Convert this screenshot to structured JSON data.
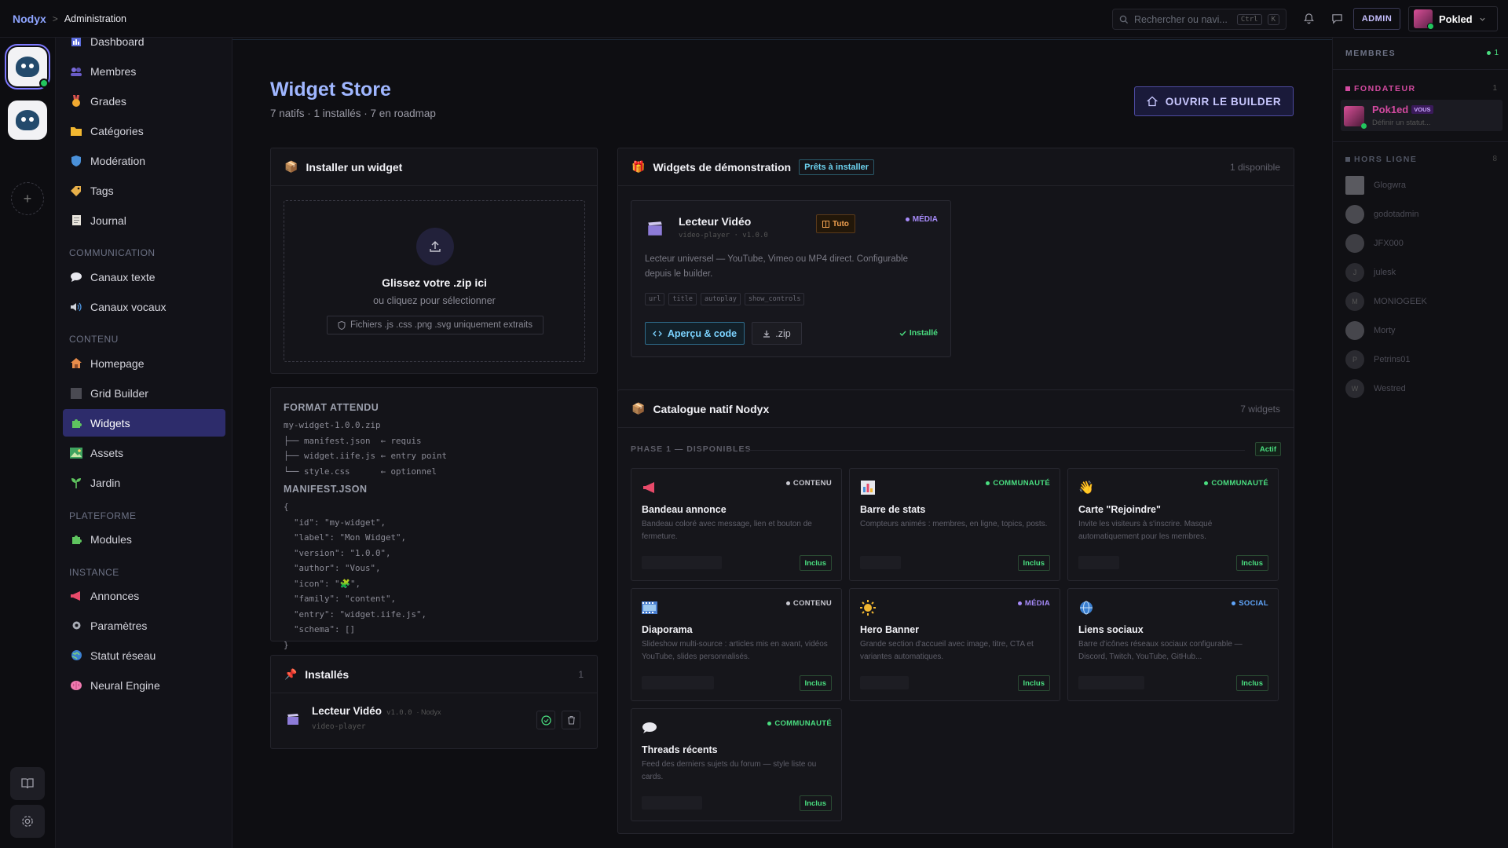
{
  "topbar": {
    "brand": "Nodyx",
    "separator": ">",
    "page": "Administration",
    "search_placeholder": "Rechercher ou navi...",
    "kbd1": "Ctrl",
    "kbd2": "K",
    "admin_badge": "ADMIN",
    "user_name": "Pokled"
  },
  "sidebar": {
    "items": [
      {
        "label": "Dashboard",
        "icon": "dashboard-icon"
      },
      {
        "label": "Membres",
        "icon": "members-icon"
      },
      {
        "label": "Grades",
        "icon": "medal-icon"
      },
      {
        "label": "Catégories",
        "icon": "folder-icon"
      },
      {
        "label": "Modération",
        "icon": "shield-icon"
      },
      {
        "label": "Tags",
        "icon": "tag-icon"
      },
      {
        "label": "Journal",
        "icon": "journal-icon"
      }
    ],
    "sec_communication": "COMMUNICATION",
    "communication": [
      {
        "label": "Canaux texte",
        "icon": "chat-bubble-icon"
      },
      {
        "label": "Canaux vocaux",
        "icon": "speaker-icon"
      }
    ],
    "sec_contenu": "CONTENU",
    "contenu": [
      {
        "label": "Homepage",
        "icon": "house-icon"
      },
      {
        "label": "Grid Builder",
        "icon": "grid-icon"
      },
      {
        "label": "Widgets",
        "icon": "puzzle-icon"
      },
      {
        "label": "Assets",
        "icon": "image-icon"
      },
      {
        "label": "Jardin",
        "icon": "sprout-icon"
      }
    ],
    "sec_plateforme": "PLATEFORME",
    "plateforme": [
      {
        "label": "Modules",
        "icon": "puzzle-icon"
      }
    ],
    "sec_instance": "INSTANCE",
    "instance": [
      {
        "label": "Annonces",
        "icon": "megaphone-icon"
      },
      {
        "label": "Paramètres",
        "icon": "gear-icon"
      },
      {
        "label": "Statut réseau",
        "icon": "globe-icon"
      },
      {
        "label": "Neural Engine",
        "icon": "brain-icon"
      }
    ]
  },
  "header": {
    "title": "Widget Store",
    "subtitle": "7 natifs · 1 installés · 7 en roadmap",
    "builder_button": "OUVRIR LE BUILDER"
  },
  "install": {
    "title": "Installer un widget",
    "drop_title": "Glissez votre .zip ici",
    "drop_sub": "ou cliquez pour sélectionner",
    "drop_note": "Fichiers .js .css .png .svg uniquement extraits"
  },
  "format": {
    "title": "FORMAT ATTENDU",
    "tree": "my-widget-1.0.0.zip\n├── manifest.json  ← requis\n├── widget.iife.js ← entry point\n└── style.css      ← optionnel",
    "manifest_title": "MANIFEST.JSON",
    "manifest": "{\n  \"id\": \"my-widget\",\n  \"label\": \"Mon Widget\",\n  \"version\": \"1.0.0\",\n  \"author\": \"Vous\",\n  \"icon\": \"🧩\",\n  \"family\": \"content\",\n  \"entry\": \"widget.iife.js\",\n  \"schema\": []\n}"
  },
  "installed": {
    "title": "Installés",
    "count": "1",
    "name": "Lecteur Vidéo",
    "version": "v1.0.0",
    "author": "· Nodyx",
    "id": "video-player"
  },
  "demo": {
    "title": "Widgets de démonstration",
    "badge": "Prêts à installer",
    "count": "1 disponible",
    "card": {
      "name": "Lecteur Vidéo",
      "meta": "video-player · v1.0.0",
      "tuto": "Tuto",
      "category": "MÉDIA",
      "desc": "Lecteur universel — YouTube, Vimeo ou MP4 direct. Configurable depuis le builder.",
      "tags": [
        "url",
        "title",
        "autoplay",
        "show_controls"
      ],
      "preview_btn": "Aperçu & code",
      "zip_btn": ".zip",
      "status": "Installé"
    }
  },
  "catalog": {
    "title": "Catalogue natif Nodyx",
    "count": "7 widgets",
    "phase": "PHASE 1 — DISPONIBLES",
    "phase_badge": "Actif",
    "included_label": "Inclus",
    "widgets": [
      {
        "name": "Bandeau annonce",
        "category": "CONTENU",
        "color": "#c8c8d0",
        "icon": "megaphone-icon",
        "desc": "Bandeau coloré avec message, lien et bouton de fermeture."
      },
      {
        "name": "Barre de stats",
        "category": "COMMUNAUTÉ",
        "color": "#4ade80",
        "icon": "bar-chart-icon",
        "desc": "Compteurs animés : membres, en ligne, topics, posts."
      },
      {
        "name": "Carte \"Rejoindre\"",
        "category": "COMMUNAUTÉ",
        "color": "#4ade80",
        "icon": "wave-hand-icon",
        "desc": "Invite les visiteurs à s'inscrire. Masqué automatiquement pour les membres."
      },
      {
        "name": "Diaporama",
        "category": "CONTENU",
        "color": "#c8c8d0",
        "icon": "film-icon",
        "desc": "Slideshow multi-source : articles mis en avant, vidéos YouTube, slides personnalisés."
      },
      {
        "name": "Hero Banner",
        "category": "MÉDIA",
        "color": "#a78bfa",
        "icon": "sun-icon",
        "desc": "Grande section d'accueil avec image, titre, CTA et variantes automatiques."
      },
      {
        "name": "Liens sociaux",
        "category": "SOCIAL",
        "color": "#60a5fa",
        "icon": "globe-icon",
        "desc": "Barre d'icônes réseaux sociaux configurable — Discord, Twitch, YouTube, GitHub..."
      },
      {
        "name": "Threads récents",
        "category": "COMMUNAUTÉ",
        "color": "#4ade80",
        "icon": "speech-bubble-icon",
        "desc": "Feed des derniers sujets du forum — style liste ou cards."
      }
    ]
  },
  "members": {
    "title": "MEMBRES",
    "online_count": "1",
    "founder_label": "FONDATEUR",
    "founder_count": "1",
    "founder_name": "Pok1ed",
    "founder_badge": "VOUS",
    "founder_status": "Définir un statut...",
    "offline_label": "HORS LIGNE",
    "offline_count": "8",
    "offline": [
      "Glogwra",
      "godotadmin",
      "JFX000",
      "julesk",
      "MONIOGEEK",
      "Morty",
      "Petrins01",
      "Westred"
    ]
  }
}
